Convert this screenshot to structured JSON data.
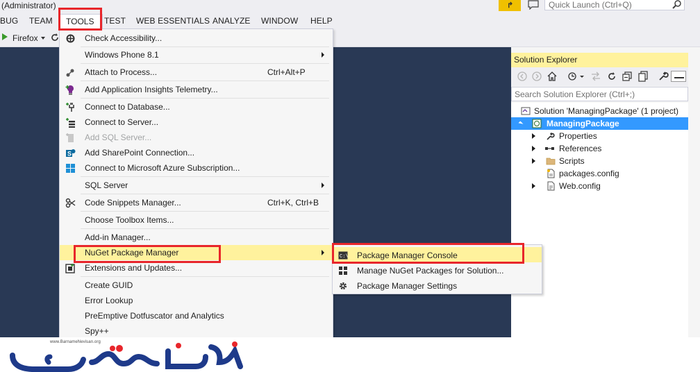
{
  "window": {
    "title": "(Administrator)"
  },
  "quick_launch": {
    "placeholder": "Quick Launch (Ctrl+Q)"
  },
  "menubar": [
    "BUG",
    "TEAM",
    "TOOLS",
    "TEST",
    "WEB ESSENTIALS",
    "ANALYZE",
    "WINDOW",
    "HELP"
  ],
  "toolbar": {
    "run_target": "Firefox"
  },
  "tools_menu": {
    "items": [
      {
        "label": "Check Accessibility...",
        "icon": "accessibility-icon"
      },
      {
        "label": "Windows Phone 8.1",
        "submenu": true
      },
      {
        "label": "Attach to Process...",
        "shortcut": "Ctrl+Alt+P",
        "icon": "attach-icon"
      },
      {
        "label": "Add Application Insights Telemetry...",
        "icon": "insights-icon"
      },
      {
        "label": "Connect to Database...",
        "icon": "database-plug-icon"
      },
      {
        "label": "Connect to Server...",
        "icon": "server-plug-icon"
      },
      {
        "label": "Add SQL Server...",
        "icon": "sql-server-icon",
        "disabled": true
      },
      {
        "label": "Add SharePoint Connection...",
        "icon": "sharepoint-icon"
      },
      {
        "label": "Connect to Microsoft Azure Subscription...",
        "icon": "azure-icon"
      },
      {
        "label": "SQL Server",
        "submenu": true
      },
      {
        "label": "Code Snippets Manager...",
        "shortcut": "Ctrl+K, Ctrl+B",
        "icon": "snippets-icon"
      },
      {
        "label": "Choose Toolbox Items..."
      },
      {
        "label": "Add-in Manager..."
      },
      {
        "label": "NuGet Package Manager",
        "submenu": true,
        "active": true
      },
      {
        "label": "Extensions and Updates...",
        "icon": "extensions-icon"
      },
      {
        "label": "Create GUID"
      },
      {
        "label": "Error Lookup"
      },
      {
        "label": "PreEmptive Dotfuscator and Analytics"
      },
      {
        "label": "Spy++"
      }
    ]
  },
  "nuget_submenu": {
    "items": [
      {
        "label": "Package Manager Console",
        "icon": "console-icon",
        "active": true
      },
      {
        "label": "Manage NuGet Packages for Solution...",
        "icon": "packages-icon"
      },
      {
        "label": "Package Manager Settings",
        "icon": "gear-icon"
      }
    ]
  },
  "solution_explorer": {
    "title": "Solution Explorer",
    "search_placeholder": "Search Solution Explorer (Ctrl+;)",
    "tree": [
      {
        "label": "Solution 'ManagingPackage' (1 project)",
        "icon": "solution-icon"
      },
      {
        "label": "ManagingPackage",
        "icon": "web-project-icon",
        "selected": true
      },
      {
        "label": "Properties",
        "icon": "wrench-icon"
      },
      {
        "label": "References",
        "icon": "references-icon"
      },
      {
        "label": "Scripts",
        "icon": "folder-icon"
      },
      {
        "label": "packages.config",
        "icon": "config-file-icon"
      },
      {
        "label": "Web.config",
        "icon": "config-file-icon"
      }
    ]
  },
  "watermark": {
    "url": "www.BarnameNevisan.org"
  },
  "colors": {
    "editor_bg": "#293955",
    "menu_highlight": "#fff29d",
    "selection": "#3399ff",
    "callout_red": "#e8262b"
  }
}
